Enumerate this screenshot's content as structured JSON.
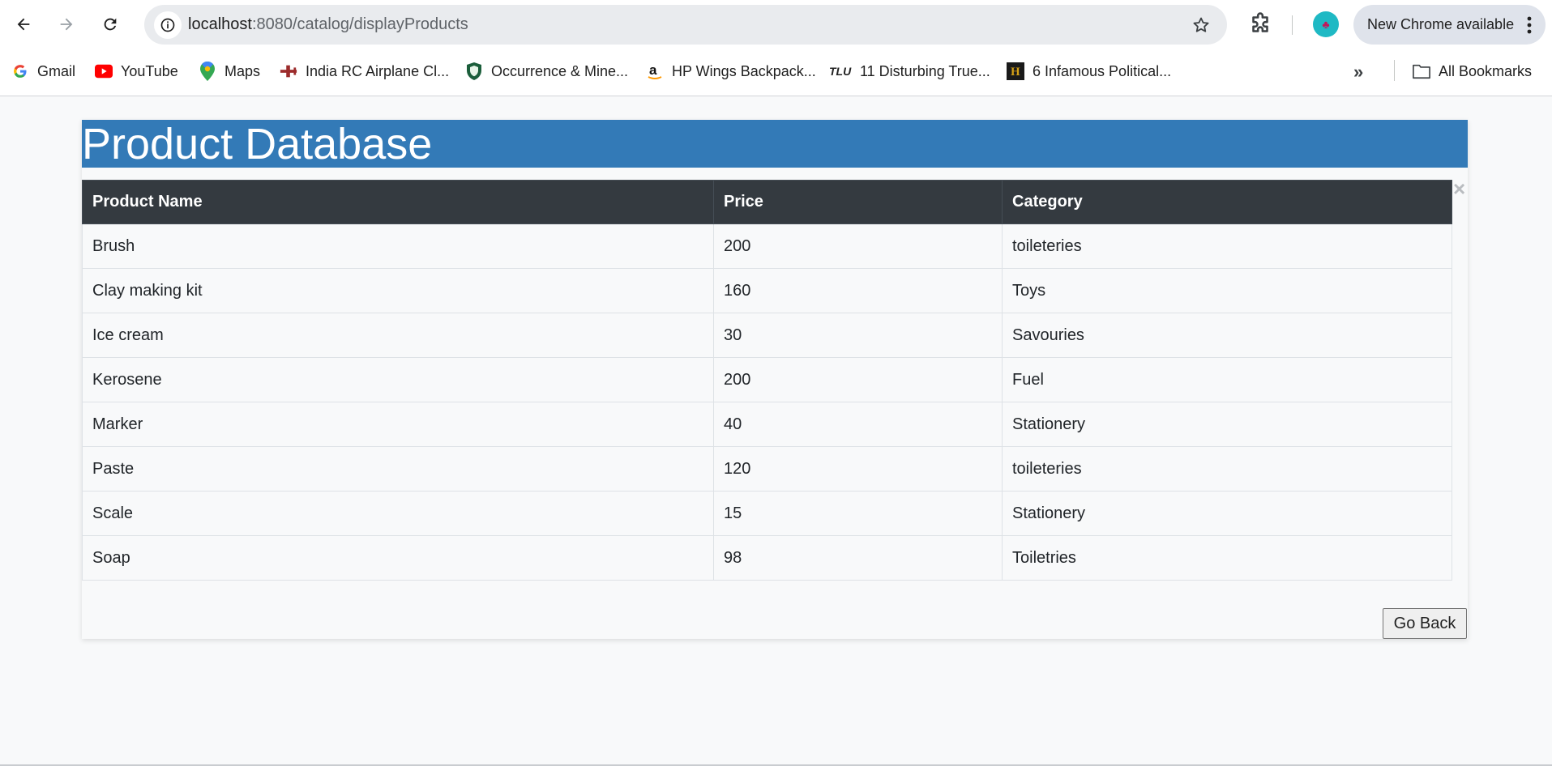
{
  "browser": {
    "url_host": "localhost",
    "url_rest": ":8080/catalog/displayProducts",
    "update_label": "New Chrome available",
    "bookmarks": [
      {
        "label": "Gmail",
        "icon": "gmail-icon"
      },
      {
        "label": "YouTube",
        "icon": "youtube-icon"
      },
      {
        "label": "Maps",
        "icon": "maps-icon"
      },
      {
        "label": "India RC Airplane Cl...",
        "icon": "airplane-icon"
      },
      {
        "label": "Occurrence & Mine...",
        "icon": "shield-icon"
      },
      {
        "label": "HP Wings Backpack...",
        "icon": "amazon-icon"
      },
      {
        "label": "11 Disturbing True...",
        "icon": "tlu-icon"
      },
      {
        "label": "6 Infamous Political...",
        "icon": "history-icon"
      }
    ],
    "more_bookmarks": "»",
    "all_bookmarks_label": "All Bookmarks",
    "colors": {
      "accent": "#337ab7",
      "table_header": "#343a40"
    }
  },
  "page": {
    "title": "Product Database",
    "close_symbol": "×",
    "columns": [
      "Product Name",
      "Price",
      "Category"
    ],
    "rows": [
      [
        "Brush",
        "200",
        "toileteries"
      ],
      [
        "Clay making kit",
        "160",
        "Toys"
      ],
      [
        "Ice cream",
        "30",
        "Savouries"
      ],
      [
        "Kerosene",
        "200",
        "Fuel"
      ],
      [
        "Marker",
        "40",
        "Stationery"
      ],
      [
        "Paste",
        "120",
        "toileteries"
      ],
      [
        "Scale",
        "15",
        "Stationery"
      ],
      [
        "Soap",
        "98",
        "Toiletries"
      ]
    ],
    "go_back_label": "Go Back"
  }
}
